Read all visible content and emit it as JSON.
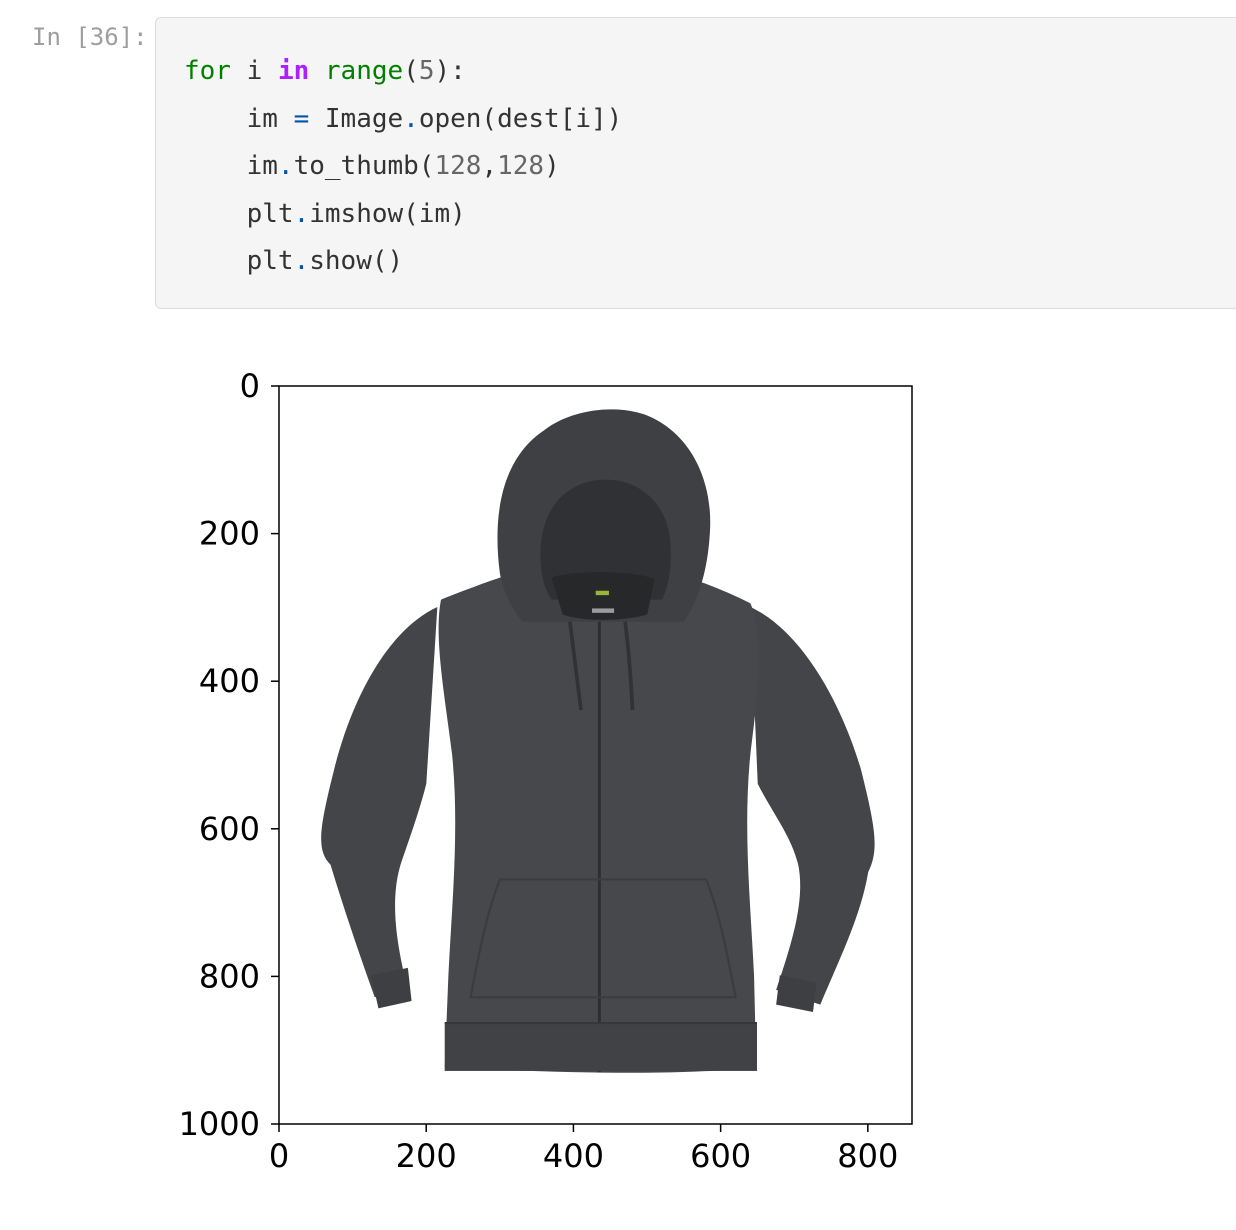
{
  "cell": {
    "prompt": "In [36]:",
    "code_lines": [
      [
        {
          "t": "for",
          "c": "kw"
        },
        {
          "t": " i "
        },
        {
          "t": "in",
          "c": "kw2"
        },
        {
          "t": " "
        },
        {
          "t": "range",
          "c": "kw"
        },
        {
          "t": "("
        },
        {
          "t": "5",
          "c": "num"
        },
        {
          "t": "):"
        }
      ],
      [
        {
          "t": "    im "
        },
        {
          "t": "=",
          "c": "op"
        },
        {
          "t": " Image"
        },
        {
          "t": ".",
          "c": "op"
        },
        {
          "t": "open(dest[i])"
        }
      ],
      [
        {
          "t": "    im"
        },
        {
          "t": ".",
          "c": "op"
        },
        {
          "t": "to_thumb("
        },
        {
          "t": "128",
          "c": "num"
        },
        {
          "t": ","
        },
        {
          "t": "128",
          "c": "num"
        },
        {
          "t": ")"
        }
      ],
      [
        {
          "t": "    plt"
        },
        {
          "t": ".",
          "c": "op"
        },
        {
          "t": "imshow(im)"
        }
      ],
      [
        {
          "t": "    plt"
        },
        {
          "t": ".",
          "c": "op"
        },
        {
          "t": "show()"
        }
      ]
    ]
  },
  "output": {
    "image_subject": "dark gray full-zip hoodie",
    "colors": {
      "hoodie_body": "#46484b",
      "hoodie_shadow": "#2c2e31",
      "hoodie_highlight": "#54565a"
    }
  },
  "chart_data": {
    "type": "image",
    "xticks": [
      "0",
      "200",
      "400",
      "600",
      "800"
    ],
    "yticks": [
      "0",
      "200",
      "400",
      "600",
      "800",
      "1000"
    ],
    "xlim": [
      0,
      860
    ],
    "ylim": [
      1000,
      0
    ]
  }
}
